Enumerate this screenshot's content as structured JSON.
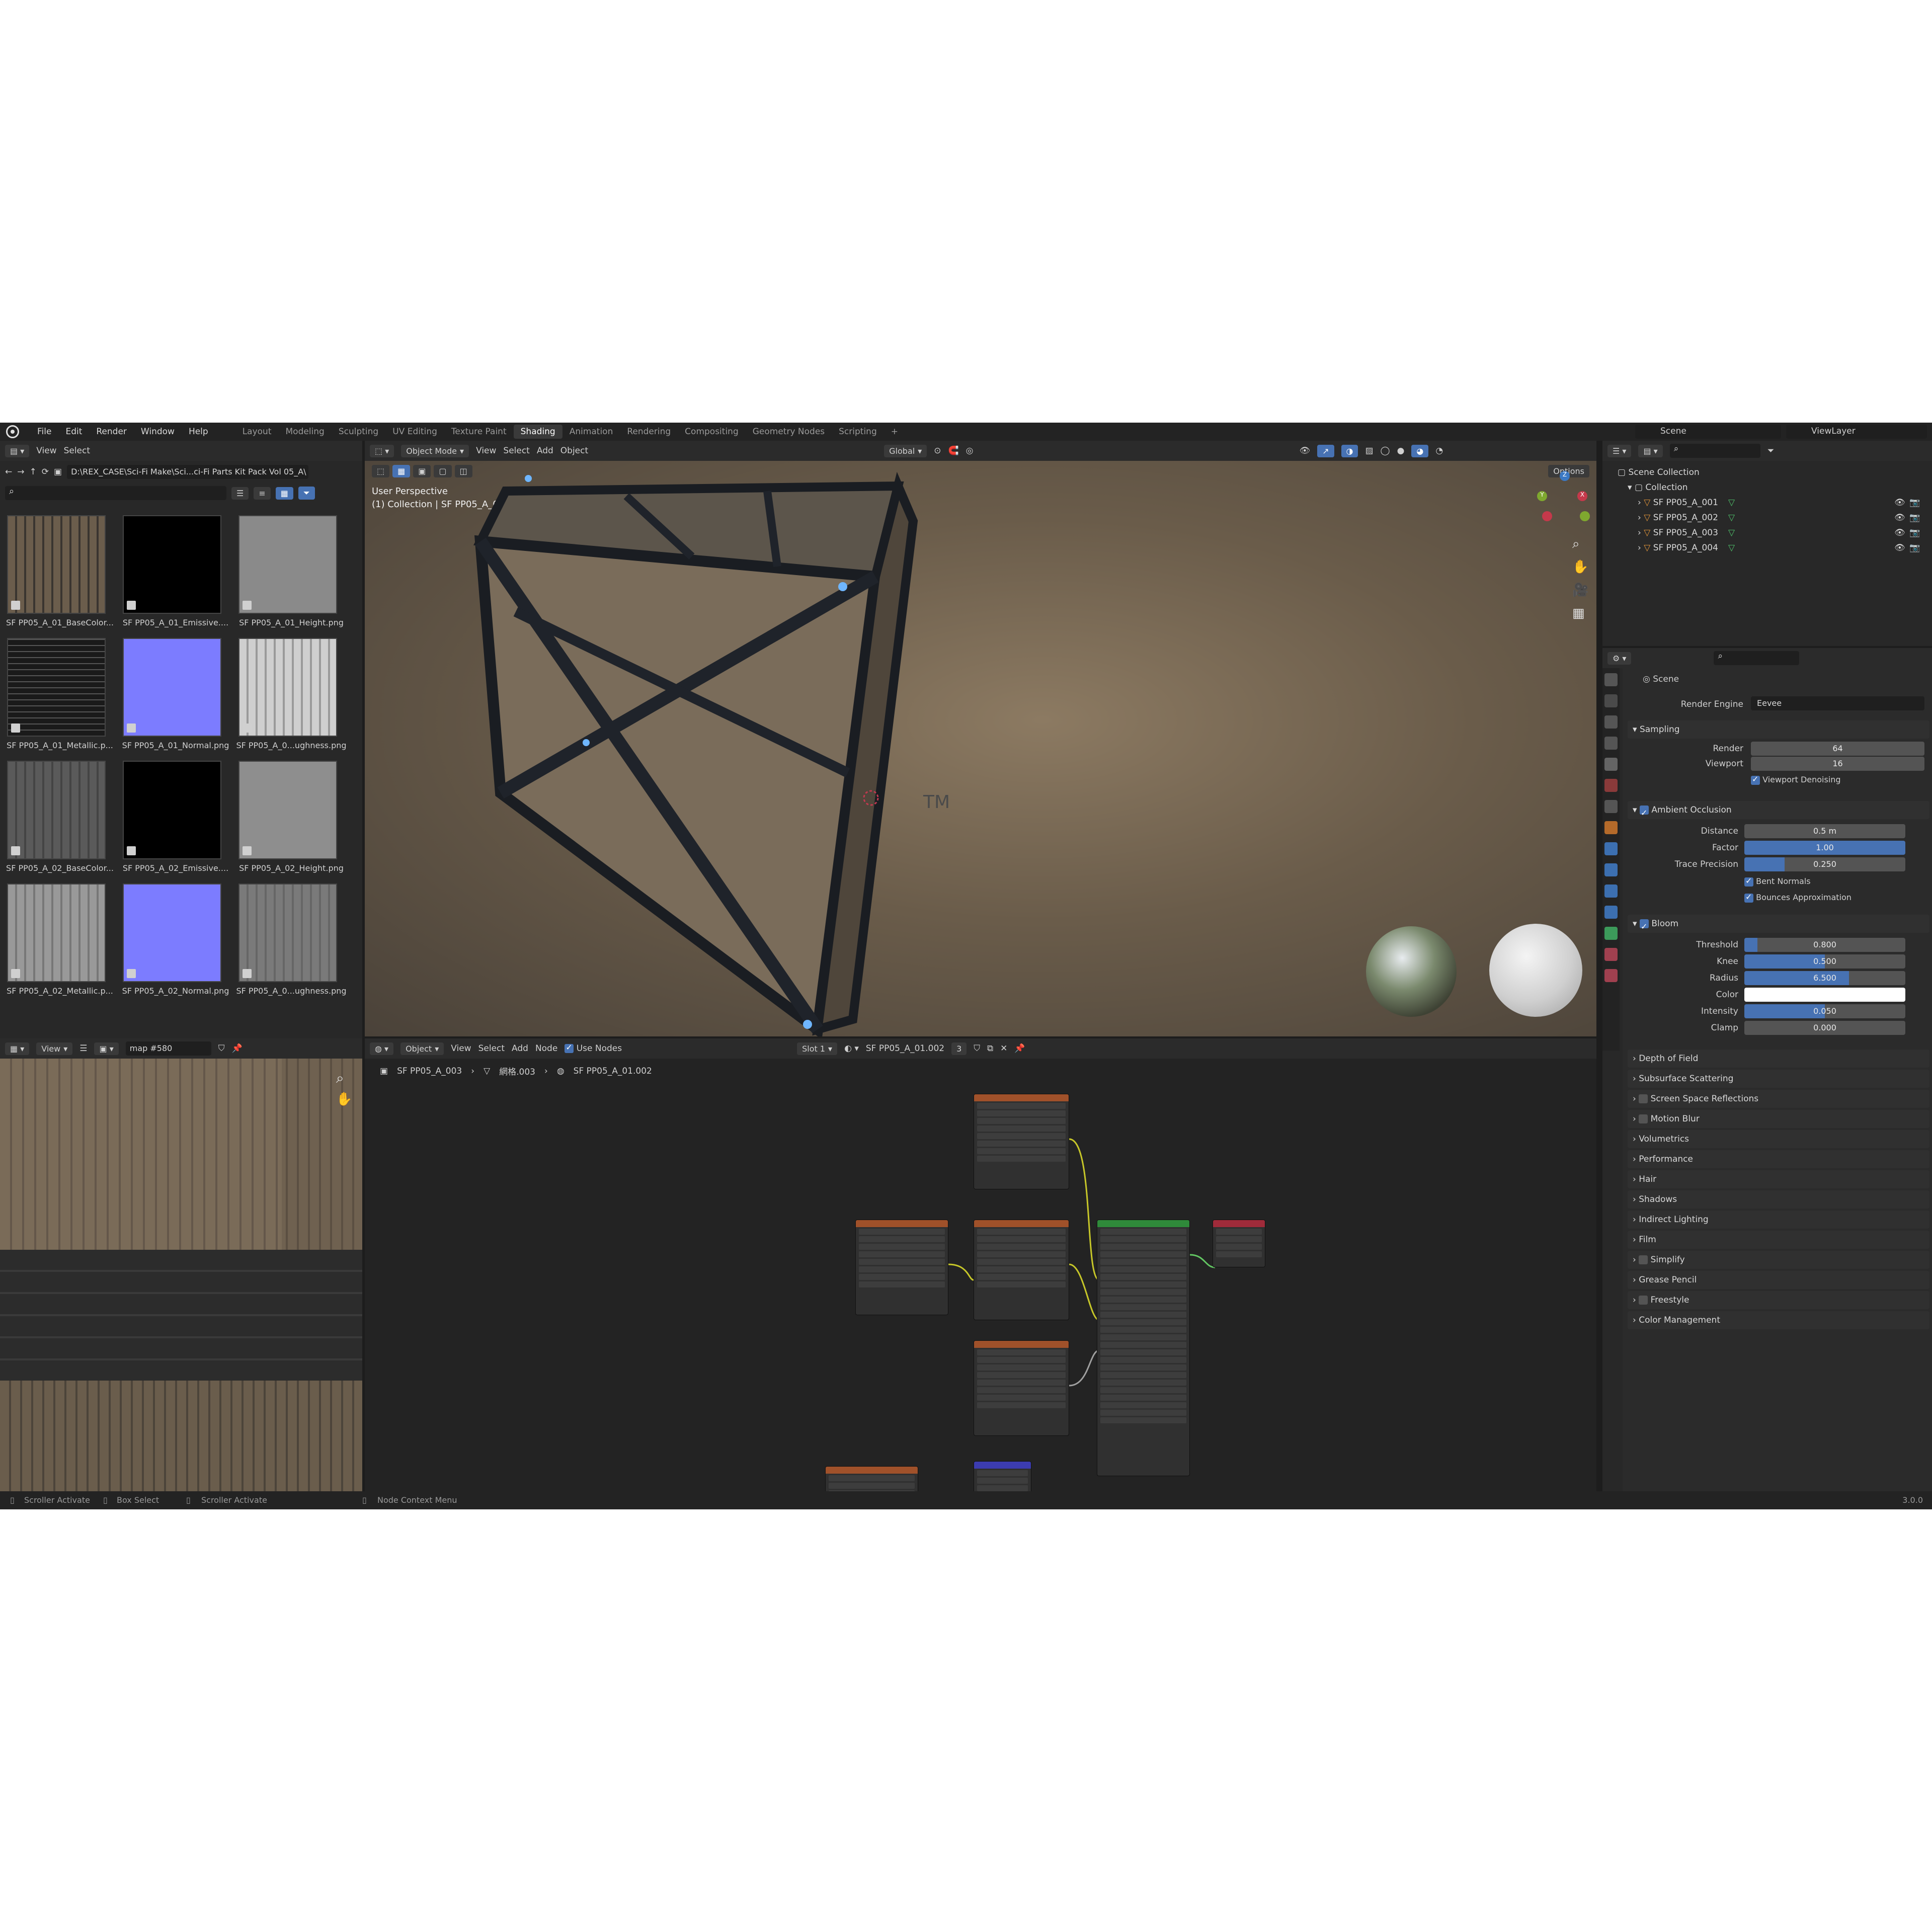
{
  "topbar": {
    "menus": [
      "File",
      "Edit",
      "Render",
      "Window",
      "Help"
    ],
    "workspaces": [
      "Layout",
      "Modeling",
      "Sculpting",
      "UV Editing",
      "Texture Paint",
      "Shading",
      "Animation",
      "Rendering",
      "Compositing",
      "Geometry Nodes",
      "Scripting"
    ],
    "active_workspace": "Shading",
    "add": "+",
    "scene": "Scene",
    "view_layer": "ViewLayer"
  },
  "file_browser": {
    "menu_view": "View",
    "menu_select": "Select",
    "path": "D:\\REX_CASE\\Sci-Fi Make\\Sci...ci-Fi Parts Kit Pack Vol 05_A\\",
    "thumbnails": [
      {
        "label": "SF PP05_A_01_BaseColor..."
      },
      {
        "label": "SF PP05_A_01_Emissive...."
      },
      {
        "label": "SF PP05_A_01_Height.png"
      },
      {
        "label": "SF PP05_A_01_Metallic.p..."
      },
      {
        "label": "SF PP05_A_01_Normal.png"
      },
      {
        "label": "SF PP05_A_0...ughness.png"
      },
      {
        "label": "SF PP05_A_02_BaseColor..."
      },
      {
        "label": "SF PP05_A_02_Emissive...."
      },
      {
        "label": "SF PP05_A_02_Height.png"
      },
      {
        "label": "SF PP05_A_02_Metallic.p..."
      },
      {
        "label": "SF PP05_A_02_Normal.png"
      },
      {
        "label": "SF PP05_A_0...ughness.png"
      }
    ]
  },
  "viewport": {
    "mode": "Object Mode",
    "menus": [
      "View",
      "Select",
      "Add",
      "Object"
    ],
    "transform": "Global",
    "options": "Options",
    "overlay_line1": "User Perspective",
    "overlay_line2": "(1) Collection | SF PP05_A_003",
    "crate_label": "TM"
  },
  "image_editor": {
    "view": "View",
    "image_name": "map #580"
  },
  "node_editor": {
    "object_mode": "Object",
    "menus": [
      "View",
      "Select",
      "Add",
      "Node"
    ],
    "use_nodes": "Use Nodes",
    "slot": "Slot 1",
    "material": "SF PP05_A_01.002",
    "users": "3",
    "breadcrumb": [
      "SF PP05_A_003",
      "網格.003",
      "SF PP05_A_01.002"
    ]
  },
  "outliner": {
    "scene_collection": "Scene Collection",
    "collection": "Collection",
    "objects": [
      "SF PP05_A_001",
      "SF PP05_A_002",
      "SF PP05_A_003",
      "SF PP05_A_004"
    ]
  },
  "properties": {
    "context": "Scene",
    "render_engine_label": "Render Engine",
    "render_engine": "Eevee",
    "sampling": {
      "title": "Sampling",
      "render_label": "Render",
      "render": "64",
      "viewport_label": "Viewport",
      "viewport": "16",
      "denoise": "Viewport Denoising"
    },
    "ao": {
      "title": "Ambient Occlusion",
      "distance_label": "Distance",
      "distance": "0.5 m",
      "factor_label": "Factor",
      "factor": "1.00",
      "trace_label": "Trace Precision",
      "trace": "0.250",
      "bent": "Bent Normals",
      "bounces": "Bounces Approximation"
    },
    "bloom": {
      "title": "Bloom",
      "threshold_label": "Threshold",
      "threshold": "0.800",
      "knee_label": "Knee",
      "knee": "0.500",
      "radius_label": "Radius",
      "radius": "6.500",
      "color_label": "Color",
      "intensity_label": "Intensity",
      "intensity": "0.050",
      "clamp_label": "Clamp",
      "clamp": "0.000"
    },
    "sections": [
      "Depth of Field",
      "Subsurface Scattering",
      "Screen Space Reflections",
      "Motion Blur",
      "Volumetrics",
      "Performance",
      "Hair",
      "Shadows",
      "Indirect Lighting",
      "Film",
      "Simplify",
      "Grease Pencil",
      "Freestyle",
      "Color Management"
    ]
  },
  "statusbar": {
    "items": [
      "Scroller Activate",
      "Box Select",
      "Scroller Activate",
      "Node Context Menu"
    ],
    "version": "3.0.0"
  },
  "colors": {
    "accent": "#4772b3",
    "background": "#1d1d1d",
    "panel": "#282828"
  }
}
